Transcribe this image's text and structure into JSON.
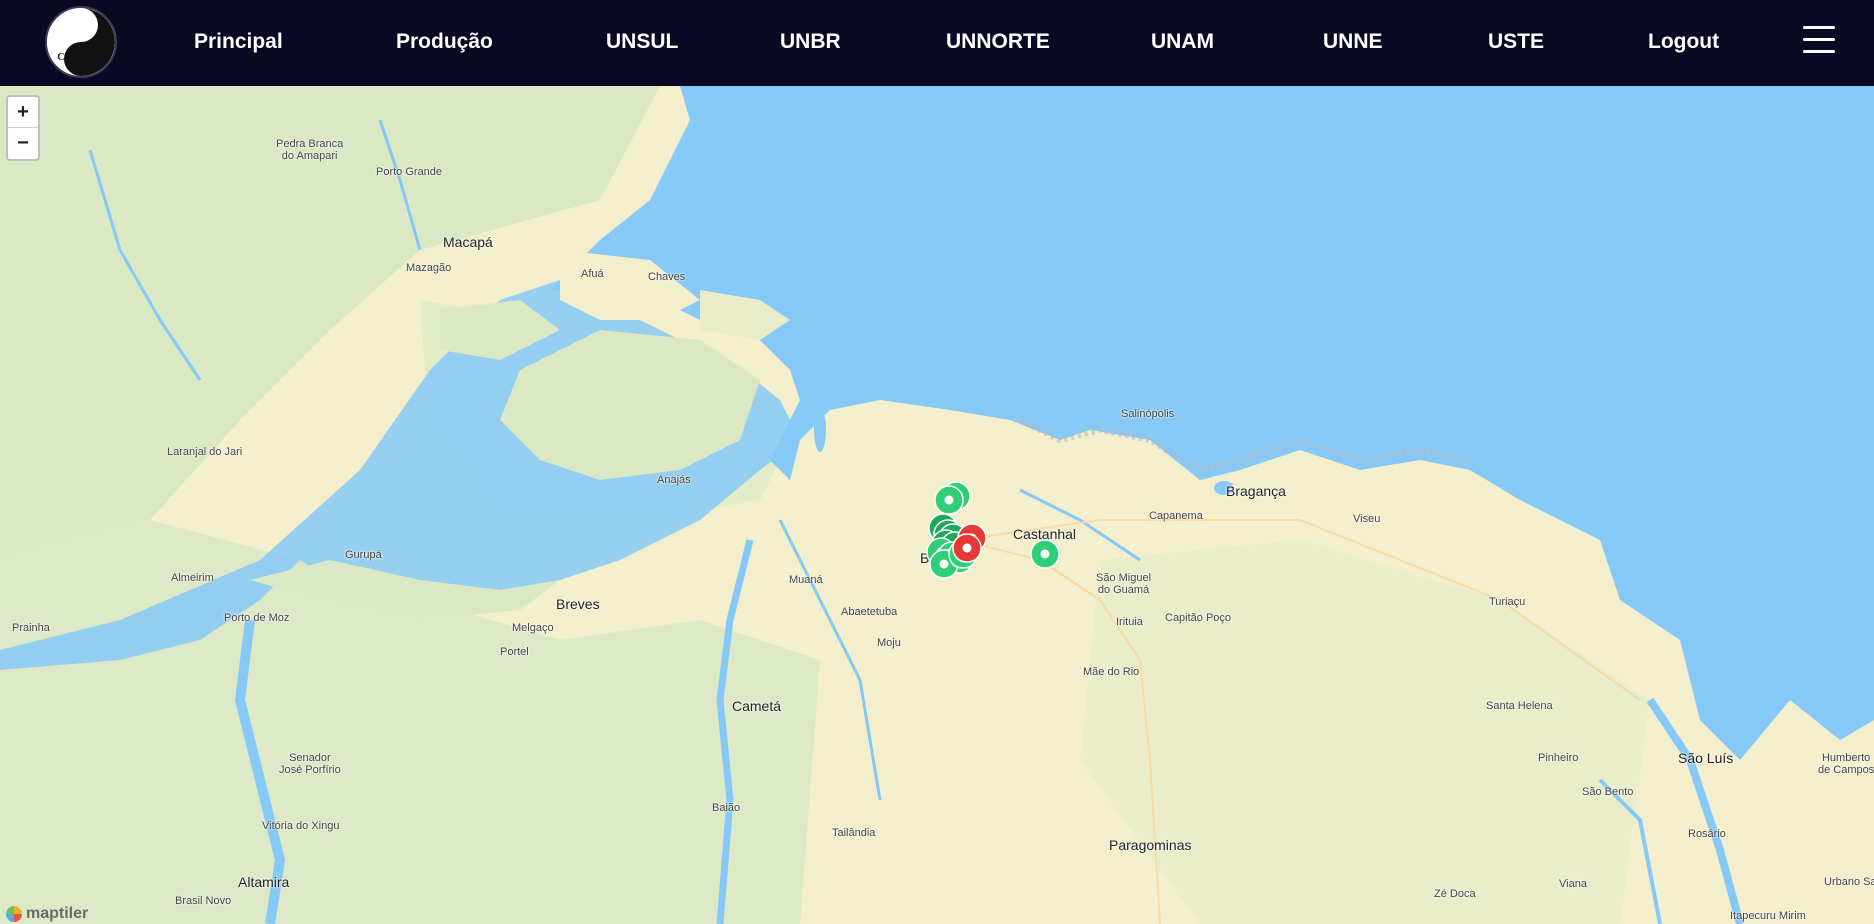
{
  "app": {
    "logo_text": "COSANPA"
  },
  "nav": {
    "items": [
      {
        "label": "Principal"
      },
      {
        "label": "Produção"
      },
      {
        "label": "UNSUL"
      },
      {
        "label": "UNBR"
      },
      {
        "label": "UNNORTE"
      },
      {
        "label": "UNAM"
      },
      {
        "label": "UNNE"
      },
      {
        "label": "USTE"
      },
      {
        "label": "Logout"
      }
    ],
    "menu_icon": "hamburger-menu-icon"
  },
  "map": {
    "zoom_in_label": "+",
    "zoom_out_label": "−",
    "attribution": "maptiler",
    "colors": {
      "water": "#86c9f7",
      "land": "#f3eecb",
      "forest": "#dbe8c4",
      "marker_ok": "#2ecc71",
      "marker_alert": "#e53935"
    },
    "places": [
      {
        "name": "Pedra Branca do Amapari",
        "line1": "Pedra Branca",
        "line2": "do Amapari"
      },
      {
        "name": "Porto Grande"
      },
      {
        "name": "Macapá",
        "major": true
      },
      {
        "name": "Mazagão"
      },
      {
        "name": "Afuá"
      },
      {
        "name": "Chaves"
      },
      {
        "name": "Laranjal do Jari"
      },
      {
        "name": "Anajás"
      },
      {
        "name": "Almeirim"
      },
      {
        "name": "Gurupá"
      },
      {
        "name": "Breves",
        "major": true
      },
      {
        "name": "Prainha"
      },
      {
        "name": "Porto de Moz"
      },
      {
        "name": "Melgaço"
      },
      {
        "name": "Portel"
      },
      {
        "name": "Muaná"
      },
      {
        "name": "Abaetetuba"
      },
      {
        "name": "Moju"
      },
      {
        "name": "Cametá",
        "major": true
      },
      {
        "name": "Senador José Porfírio",
        "line1": "Senador",
        "line2": "José Porfírio"
      },
      {
        "name": "Vitória do Xingu"
      },
      {
        "name": "Altamira",
        "major": true
      },
      {
        "name": "Brasil Novo"
      },
      {
        "name": "Baião"
      },
      {
        "name": "Tailândia"
      },
      {
        "name": "Paragominas",
        "major": true
      },
      {
        "name": "Castanhal",
        "major": true
      },
      {
        "name": "Salinópolis"
      },
      {
        "name": "Bragança",
        "major": true
      },
      {
        "name": "Capanema"
      },
      {
        "name": "Viseu"
      },
      {
        "name": "São Miguel do Guamá",
        "line1": "São Miguel",
        "line2": "do Guamá"
      },
      {
        "name": "Irituia"
      },
      {
        "name": "Capitão Poço"
      },
      {
        "name": "Mãe do Rio"
      },
      {
        "name": "Turiaçu"
      },
      {
        "name": "Santa Helena"
      },
      {
        "name": "Pinheiro"
      },
      {
        "name": "São Bento"
      },
      {
        "name": "São Luís",
        "major": true
      },
      {
        "name": "Rosário"
      },
      {
        "name": "Humberto de Campos",
        "line1": "Humberto",
        "line2": "de Campos"
      },
      {
        "name": "Viana"
      },
      {
        "name": "Zé Doca"
      },
      {
        "name": "Urbano Santos"
      },
      {
        "name": "Itapecuru Mirim"
      },
      {
        "name": "Belém",
        "display": "B",
        "major": true
      }
    ]
  }
}
